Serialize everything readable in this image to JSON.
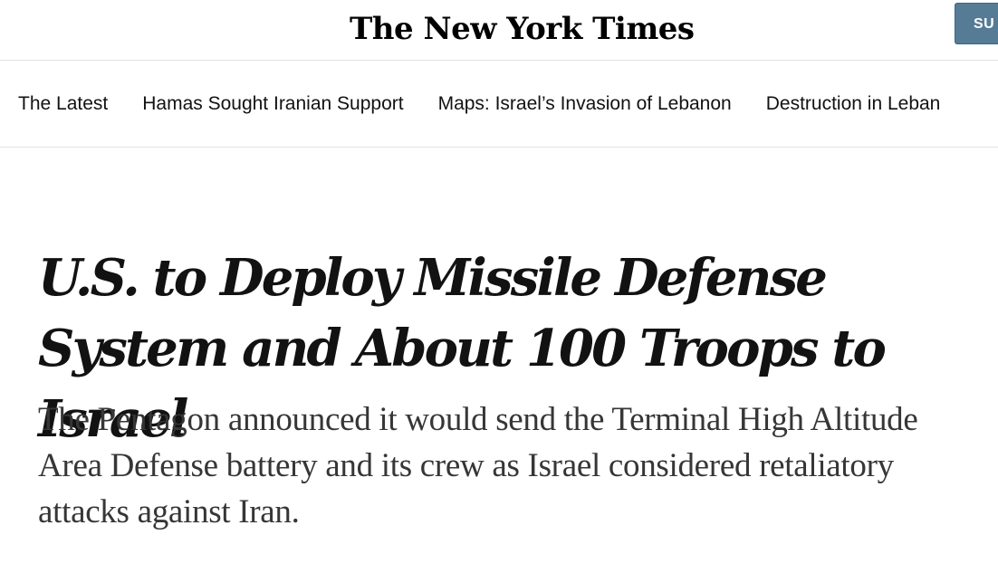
{
  "masthead": {
    "logo_text": "The New York Times",
    "subscribe_label": "SU"
  },
  "subnav": {
    "items": [
      {
        "label": "The Latest"
      },
      {
        "label": "Hamas Sought Iranian Support"
      },
      {
        "label": "Maps: Israel’s Invasion of Lebanon"
      },
      {
        "label": "Destruction in Leban"
      }
    ]
  },
  "article": {
    "headline": "U.S. to Deploy Missile Defense System and About 100 Troops to Israel",
    "summary": "The Pentagon announced it would send the Terminal High Altitude Area Defense battery and its crew as Israel considered retaliatory attacks against Iran."
  },
  "colors": {
    "subscribe_bg": "#567b95",
    "text": "#121212",
    "summary_text": "#363636",
    "divider": "#e2e2e2"
  }
}
